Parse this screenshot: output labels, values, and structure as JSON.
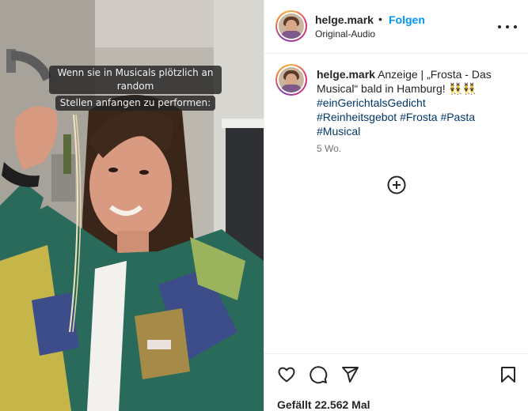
{
  "post": {
    "overlay_text_lines": [
      "Wenn sie in Musicals plötzlich an random",
      "Stellen anfangen zu performen:"
    ]
  },
  "header": {
    "username": "helge.mark",
    "separator": "•",
    "follow_label": "Folgen",
    "audio_label": "Original-Audio"
  },
  "caption": {
    "username": "helge.mark",
    "text": "Anzeige | „Frosta - Das Musical“ bald in Hamburg! 👯‍♂️👯‍♂️",
    "hashtags": [
      "#einGerichtalsGedicht",
      "#Reinheitsgebot",
      "#Frosta",
      "#Pasta",
      "#Musical"
    ],
    "time": "5 Wo."
  },
  "actions": {
    "likes_text": "Gefällt 22.562 Mal"
  },
  "colors": {
    "follow_blue": "#0095f6",
    "hashtag_navy": "#00376b",
    "muted_text": "#737373",
    "border": "#efefef"
  },
  "icons": [
    "more-options-icon",
    "load-more-comments-icon",
    "heart-icon",
    "comment-icon",
    "share-icon",
    "bookmark-icon"
  ]
}
